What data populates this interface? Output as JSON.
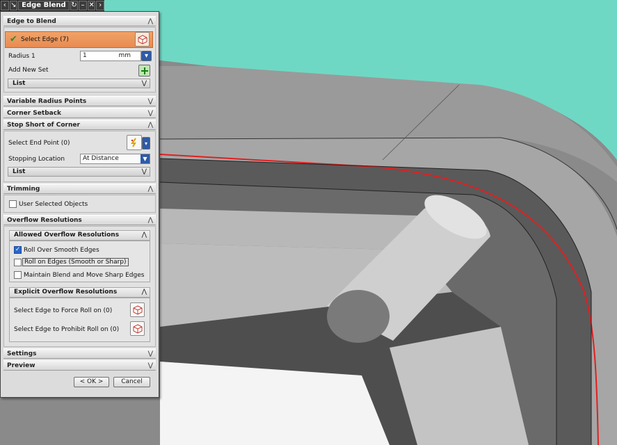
{
  "app": {
    "dialog_title": "Edge Blend"
  },
  "titlebar": {
    "icons": [
      "blend-tool-icon",
      "reset-icon",
      "minimize-icon",
      "close-icon"
    ]
  },
  "edge_to_blend": {
    "header": "Edge to Blend",
    "select_edge_label": "Select Edge (7)",
    "radius_label": "Radius 1",
    "radius_value": "1",
    "radius_unit": "mm",
    "add_new_set_label": "Add New Set",
    "list_label": "List"
  },
  "variable_radius": {
    "header": "Variable Radius Points"
  },
  "corner_setback": {
    "header": "Corner Setback"
  },
  "stop_short": {
    "header": "Stop Short of Corner",
    "select_end_point_label": "Select End Point (0)",
    "stopping_location_label": "Stopping Location",
    "stopping_location_value": "At Distance",
    "list_label": "List"
  },
  "trimming": {
    "header": "Trimming",
    "user_selected_objects_label": "User Selected Objects",
    "user_selected_objects_checked": false
  },
  "overflow": {
    "header": "Overflow Resolutions",
    "allowed_header": "Allowed Overflow Resolutions",
    "options": [
      {
        "label": "Roll Over Smooth Edges",
        "checked": true
      },
      {
        "label": "Roll on Edges (Smooth or Sharp)",
        "checked": false
      },
      {
        "label": "Maintain Blend and Move Sharp Edges",
        "checked": false
      }
    ],
    "explicit_header": "Explicit Overflow Resolutions",
    "force_roll_label": "Select Edge to Force Roll on (0)",
    "prohibit_roll_label": "Select Edge to Prohibit Roll on (0)"
  },
  "settings": {
    "header": "Settings"
  },
  "preview": {
    "header": "Preview"
  },
  "buttons": {
    "ok": "< OK >",
    "cancel": "Cancel"
  },
  "colors": {
    "background": "#6fd8c4",
    "selection_highlight": "#e88c52",
    "selected_edge": "#e02020",
    "checkbox_checked": "#2a67c9"
  }
}
